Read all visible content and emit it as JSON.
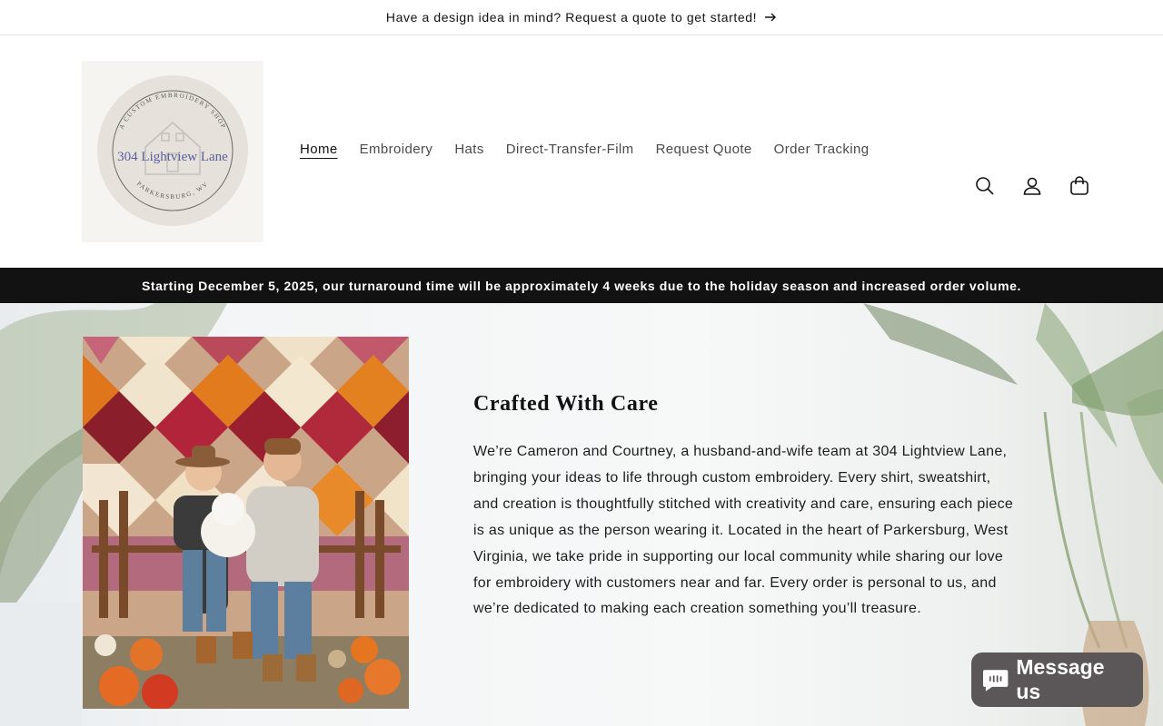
{
  "announcement": {
    "text": "Have a design idea in mind? Request a quote to get started!",
    "icon": "arrow-right-icon"
  },
  "logo": {
    "arc_top": "A CUSTOM EMBROIDERY SHOP",
    "name": "304 Lightview Lane",
    "arc_bottom": "PARKERSBURG, WV"
  },
  "nav": {
    "items": [
      {
        "label": "Home",
        "active": true
      },
      {
        "label": "Embroidery"
      },
      {
        "label": "Hats"
      },
      {
        "label": "Direct-Transfer-Film"
      },
      {
        "label": "Request Quote"
      },
      {
        "label": "Order Tracking"
      }
    ]
  },
  "header_icons": [
    "search-icon",
    "account-icon",
    "cart-icon"
  ],
  "notice": {
    "text": "Starting December 5, 2025, our turnaround time will be approximately 4 weeks due to the holiday season and increased order volume."
  },
  "about": {
    "title": "Crafted With Care",
    "body": "We’re Cameron and Courtney, a husband-and-wife team at 304 Lightview Lane, bringing your ideas to life through custom embroidery. Every shirt, sweatshirt, and creation is thoughtfully stitched with creativity and care, ensuring each piece is as unique as the person wearing it. Located in the heart of Parkersburg, West Virginia, we take pride in supporting our local community while sharing our love for embroidery with customers near and far. Every order is personal to us, and we’re dedicated to making each creation something you’ll treasure."
  },
  "chat": {
    "label": "Message us"
  },
  "colors": {
    "accent_logo": "#5a5f9e",
    "notice_bg": "#121212",
    "chat_bg": "#5b5758"
  }
}
